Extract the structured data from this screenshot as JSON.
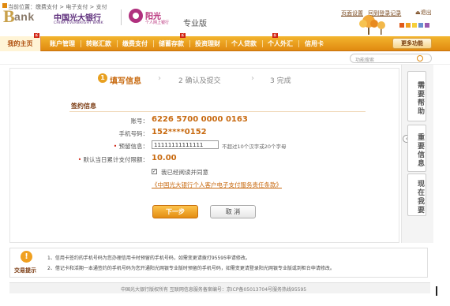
{
  "header": {
    "logo_b": "B",
    "logo_ank": "ank",
    "bank_name_cn": "中国光大银行",
    "bank_name_en": "CHINA EVERBRIGHT BANK",
    "brand_name": "阳光",
    "brand_sub": "个人网上银行",
    "edition": "专业版",
    "links": [
      "页面设置",
      "回到登录记录"
    ],
    "exit": "退出",
    "colors": [
      "#e05a1a",
      "#f0a020",
      "#f6cf3a",
      "#6a8fd0",
      "#9a5ab0"
    ]
  },
  "nav": {
    "items": [
      {
        "label": "我的主页"
      },
      {
        "label": "账户管理"
      },
      {
        "label": "转账汇款"
      },
      {
        "label": "缴费支付"
      },
      {
        "label": "储蓄存款"
      },
      {
        "label": "投资理财"
      },
      {
        "label": "个人贷款"
      },
      {
        "label": "个人外汇"
      },
      {
        "label": "信用卡"
      }
    ],
    "more": "更多功能"
  },
  "breadcrumb": "当前位置：缴费支付 > 电子支付 > 支付",
  "search": {
    "placeholder": "功能搜索"
  },
  "steps": {
    "step1": "填写信息",
    "step1_num": "1",
    "step2": "2 确认及提交",
    "step3": "3 完成"
  },
  "form": {
    "section_title": "签约信息",
    "account_label": "账号：",
    "account_value": "6226 5700 0000 0163",
    "phone_label": "手机号码：",
    "phone_value": "152****0152",
    "message_label": "预留信息：",
    "message_value": "11111111111111",
    "message_hint": "不超过10个汉字或20个字母",
    "limit_label": "默认当日累计支付限额：",
    "limit_value": "10.00",
    "agree_label": "我已经阅读并同意",
    "agree_link": "《中国光大银行个人客户电子支付服务责任条款》",
    "next_button": "下一步",
    "cancel_button": "取 消"
  },
  "side_tabs": [
    "需要帮助",
    "重要信息",
    "现在我要"
  ],
  "notice": {
    "title": "交易提示",
    "lines": [
      "1、信用卡签约的手机号码为您办理信用卡时预留的手机号码，如需变更请拨打95595申请修改。",
      "2、借记卡和活期一本通签约的手机号码为您开通阳光网银专业版时预留的手机号码，如需变更请登录阳光网银专业版或到柜台申请修改。"
    ]
  },
  "footer": "中国光大银行版权所有 互联网信息服务备案编号：京ICP备05013704号服务热线95595"
}
